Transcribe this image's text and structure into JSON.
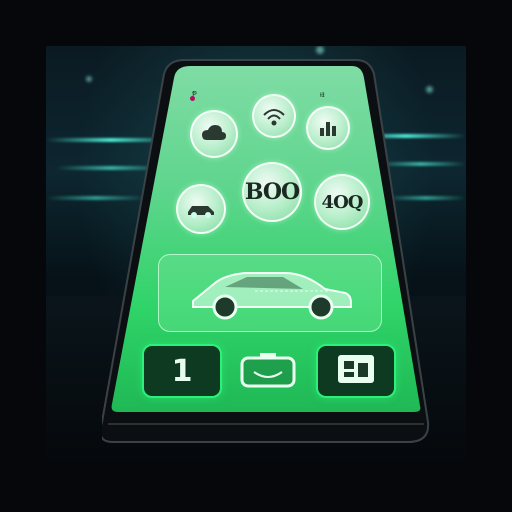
{
  "status_bar": {
    "left": "Ᵽ",
    "right": "ᵼᵻ"
  },
  "top_icons": [
    {
      "name": "cloud-icon"
    },
    {
      "name": "wifi-icon"
    },
    {
      "name": "chart-icon"
    }
  ],
  "gauges": {
    "left_icon": "car-icon",
    "speed_value": "BOO",
    "range_value": "4OQ"
  },
  "car_panel": {
    "icon": "car-icon"
  },
  "bottom_cards": [
    {
      "label": "1"
    },
    {
      "icon": "battery-icon"
    },
    {
      "icon": "grid-icon"
    }
  ],
  "colors": {
    "accent": "#2df07a",
    "screen": "#3fd27a"
  }
}
